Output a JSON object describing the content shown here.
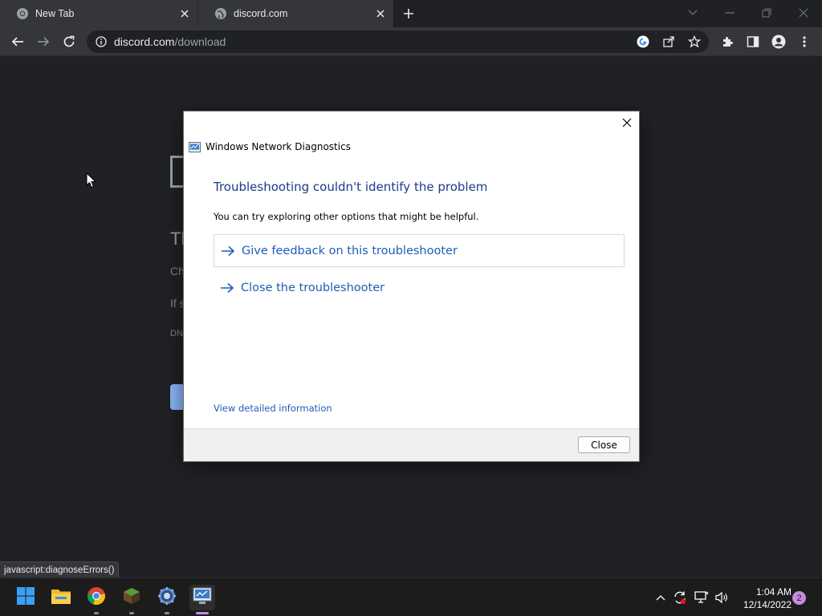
{
  "browser": {
    "tabs": [
      {
        "title": "New Tab",
        "icon": "chrome-icon"
      },
      {
        "title": "discord.com",
        "icon": "globe-icon"
      }
    ],
    "url_host": "discord.com",
    "url_path": "/download",
    "status_text": "javascript:diagnoseErrors()"
  },
  "page_background": {
    "heading_fragment": "Th",
    "line1_fragment": "Ch",
    "line2_fragment": "If s",
    "line3_fragment": "DN"
  },
  "dialog": {
    "title": "Windows Network Diagnostics",
    "heading": "Troubleshooting couldn't identify the problem",
    "subtitle": "You can try exploring other options that might be helpful.",
    "options": [
      {
        "label": "Give feedback on this troubleshooter"
      },
      {
        "label": "Close the troubleshooter"
      }
    ],
    "detail_link": "View detailed information",
    "close_button": "Close"
  },
  "taskbar": {
    "apps": [
      "start-icon",
      "file-explorer-icon",
      "chrome-icon",
      "minecraft-icon",
      "settings-icon",
      "network-diagnostics-icon"
    ],
    "clock_time": "1:04 AM",
    "clock_date": "12/14/2022",
    "notification_count": "2"
  },
  "colors": {
    "accent_link": "#1f5db5",
    "heading": "#1c3a8c",
    "browser_bg": "#202124",
    "toolbar_bg": "#35363a"
  }
}
